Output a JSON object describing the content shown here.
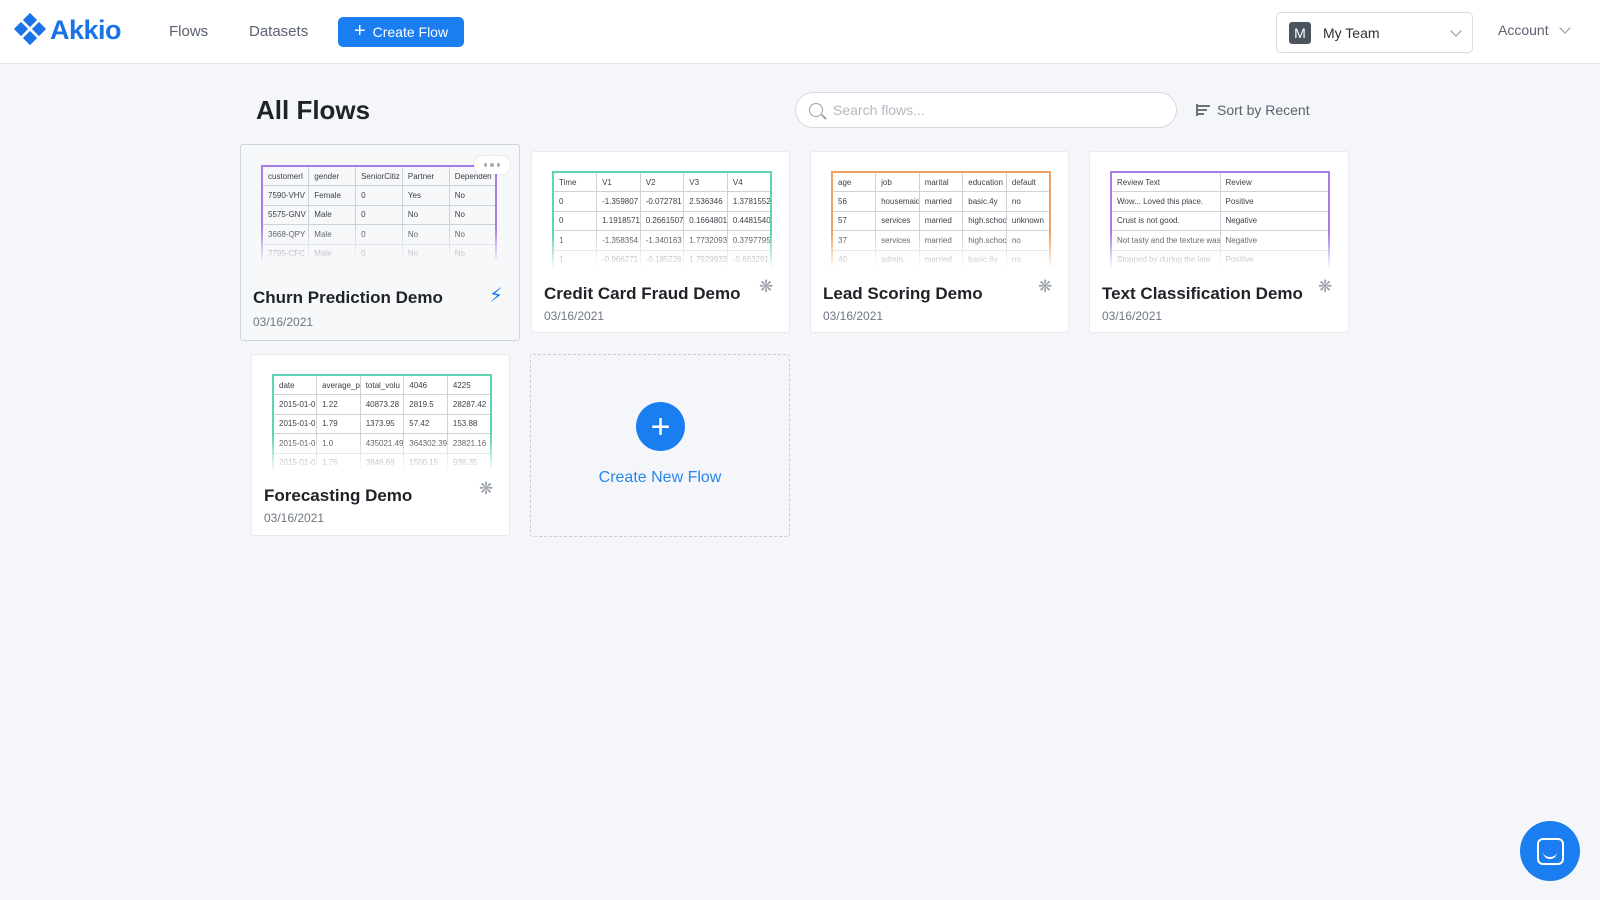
{
  "brand": {
    "name": "Akkio",
    "color": "#1a73e8"
  },
  "nav": {
    "flows": "Flows",
    "datasets": "Datasets",
    "create_flow": "Create Flow",
    "team": {
      "avatar": "M",
      "name": "My Team"
    },
    "account": "Account"
  },
  "header": {
    "title": "All Flows",
    "search_placeholder": "Search flows...",
    "sort_label": "Sort by Recent"
  },
  "cards": [
    {
      "title": "Churn Prediction Demo",
      "date": "03/16/2021",
      "icon": "bolt-icon",
      "accent": "#a77ce8",
      "table": [
        [
          "customerI",
          "gender",
          "SeniorCitiz",
          "Partner",
          "Dependen"
        ],
        [
          "7590-VHV",
          "Female",
          "0",
          "Yes",
          "No"
        ],
        [
          "5575-GNV",
          "Male",
          "0",
          "No",
          "No"
        ],
        [
          "3668-QPY",
          "Male",
          "0",
          "No",
          "No"
        ],
        [
          "7795-CFC",
          "Male",
          "0",
          "No",
          "No"
        ]
      ]
    },
    {
      "title": "Credit Card Fraud Demo",
      "date": "03/16/2021",
      "icon": "sparkle-icon",
      "accent": "#5fd3b6",
      "table": [
        [
          "Time",
          "V1",
          "V2",
          "V3",
          "V4"
        ],
        [
          "0",
          "-1.359807",
          "-0.072781",
          "2.536346",
          "1.3781552"
        ],
        [
          "0",
          "1.1918571",
          "0.2661507",
          "0.1664801",
          "0.4481540"
        ],
        [
          "1",
          "-1.358354",
          "-1.340163",
          "1.7732093",
          "0.3797795"
        ],
        [
          "1",
          "-0.966271",
          "-0.185226",
          "1.7929933",
          "-0.863291"
        ]
      ]
    },
    {
      "title": "Lead Scoring Demo",
      "date": "03/16/2021",
      "icon": "sparkle-icon",
      "accent": "#f0a060",
      "table": [
        [
          "age",
          "job",
          "marital",
          "education",
          "default"
        ],
        [
          "56",
          "housemaid",
          "married",
          "basic.4y",
          "no"
        ],
        [
          "57",
          "services",
          "married",
          "high.school",
          "unknown"
        ],
        [
          "37",
          "services",
          "married",
          "high.school",
          "no"
        ],
        [
          "40",
          "admin.",
          "married",
          "basic.6y",
          "no"
        ]
      ]
    },
    {
      "title": "Text Classification Demo",
      "date": "03/16/2021",
      "icon": "sparkle-icon",
      "accent": "#a77ce8",
      "table": [
        [
          "Review Text",
          "Review"
        ],
        [
          "Wow... Loved this place.",
          "Positive"
        ],
        [
          "Crust is not good.",
          "Negative"
        ],
        [
          "Not tasty and the texture was",
          "Negative"
        ],
        [
          "Stopped by during the late",
          "Positive"
        ]
      ]
    },
    {
      "title": "Forecasting Demo",
      "date": "03/16/2021",
      "icon": "sparkle-icon",
      "accent": "#5fd3b6",
      "table": [
        [
          "date",
          "average_p",
          "total_volu",
          "4046",
          "4225"
        ],
        [
          "2015-01-0",
          "1.22",
          "40873.28",
          "2819.5",
          "28287.42"
        ],
        [
          "2015-01-0",
          "1.79",
          "1373.95",
          "57.42",
          "153.88"
        ],
        [
          "2015-01-0",
          "1.0",
          "435021.49",
          "364302.39",
          "23821.16"
        ],
        [
          "2015-01-0",
          "1.76",
          "3846.69",
          "1500.15",
          "938.35"
        ]
      ]
    }
  ],
  "new_flow": {
    "plus": "+",
    "label": "Create New Flow"
  }
}
